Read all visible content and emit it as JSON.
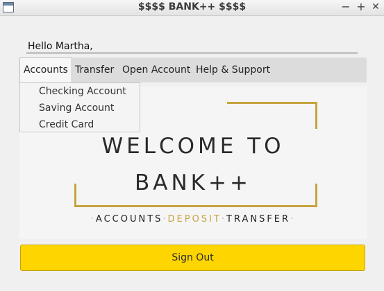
{
  "window": {
    "title": "$$$$ BANK++ $$$$",
    "minimize": "−",
    "maximize": "+",
    "close": "✕"
  },
  "greeting": "Hello Martha,",
  "menu": {
    "items": [
      "Accounts",
      "Transfer",
      "Open Account",
      "Help & Support"
    ],
    "active": "Accounts"
  },
  "dropdown": {
    "items": [
      "Checking Account",
      "Saving Account",
      "Credit Card"
    ]
  },
  "banner": {
    "line1": "WELCOME TO",
    "line2": "BANK++",
    "tag_accounts": "ACCOUNTS",
    "tag_deposit": "DEPOSIT",
    "tag_transfer": "TRANSFER",
    "dot": "·",
    "accent_color": "#c6a43f"
  },
  "signout_label": "Sign Out",
  "colors": {
    "signout_bg": "#ffd500"
  }
}
